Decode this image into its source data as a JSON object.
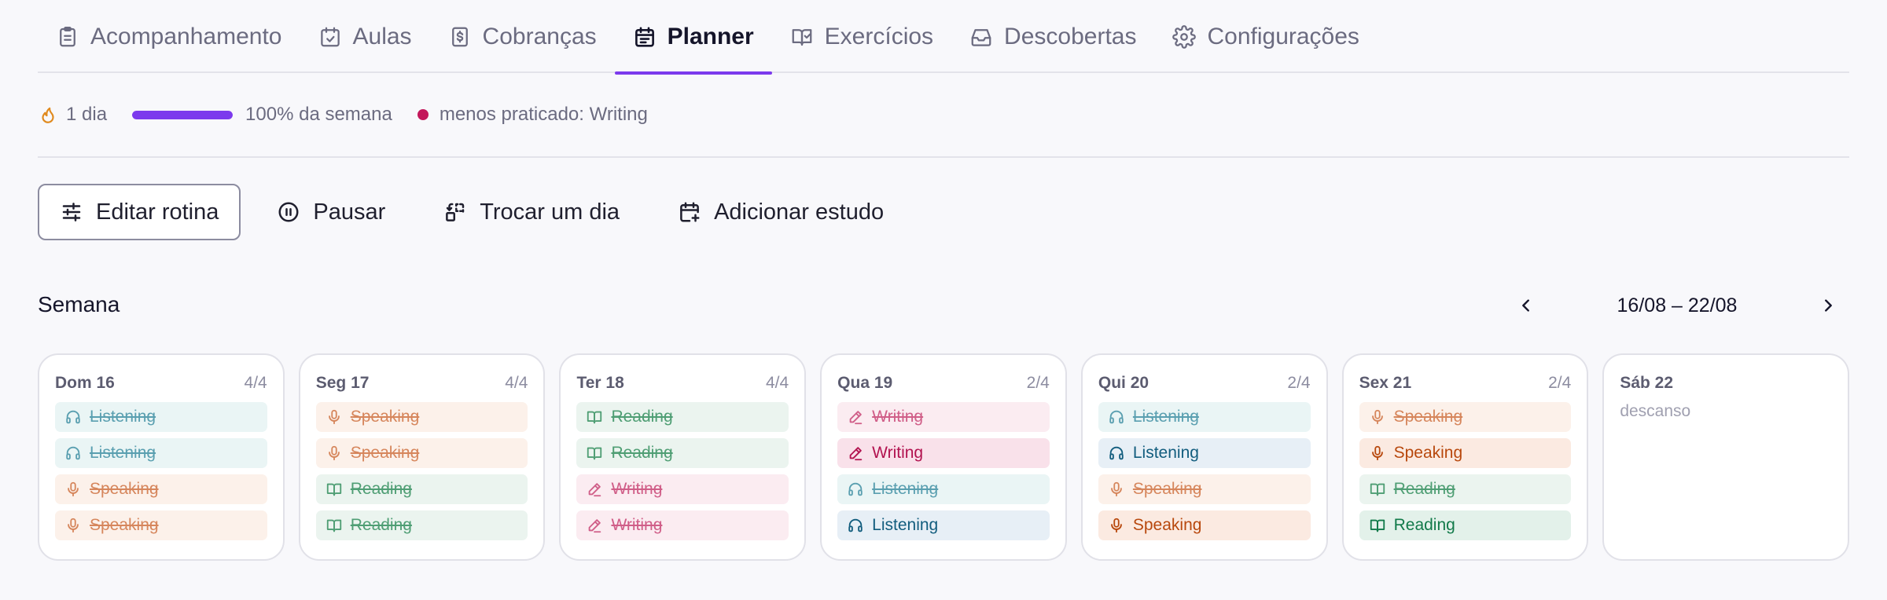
{
  "tabs": [
    {
      "label": "Acompanhamento",
      "icon": "clipboard-icon",
      "active": false
    },
    {
      "label": "Aulas",
      "icon": "calendar-check-icon",
      "active": false
    },
    {
      "label": "Cobranças",
      "icon": "receipt-dollar-icon",
      "active": false
    },
    {
      "label": "Planner",
      "icon": "calendar-planner-icon",
      "active": true
    },
    {
      "label": "Exercícios",
      "icon": "book-check-icon",
      "active": false
    },
    {
      "label": "Descobertas",
      "icon": "inbox-icon",
      "active": false
    },
    {
      "label": "Configurações",
      "icon": "gear-icon",
      "active": false
    }
  ],
  "status": {
    "streak_label": "1 dia",
    "week_progress_fraction": 1.0,
    "week_progress_label": "100% da semana",
    "least_practiced_label": "menos praticado: Writing",
    "colors": {
      "flame": "#e08a1e",
      "progress": "#7c3aed",
      "least_dot": "#c3185b"
    }
  },
  "actions": {
    "edit_routine": "Editar rotina",
    "pause": "Pausar",
    "swap_day": "Trocar um dia",
    "add_study": "Adicionar estudo"
  },
  "week": {
    "title": "Semana",
    "range": "16/08 – 22/08",
    "days": [
      {
        "name": "Dom 16",
        "count": "4/4",
        "tasks": [
          {
            "label": "Listening",
            "skill": "listening",
            "done": true
          },
          {
            "label": "Listening",
            "skill": "listening",
            "done": true
          },
          {
            "label": "Speaking",
            "skill": "speaking",
            "done": true
          },
          {
            "label": "Speaking",
            "skill": "speaking",
            "done": true
          }
        ]
      },
      {
        "name": "Seg 17",
        "count": "4/4",
        "tasks": [
          {
            "label": "Speaking",
            "skill": "speaking",
            "done": true
          },
          {
            "label": "Speaking",
            "skill": "speaking",
            "done": true
          },
          {
            "label": "Reading",
            "skill": "reading",
            "done": true
          },
          {
            "label": "Reading",
            "skill": "reading",
            "done": true
          }
        ]
      },
      {
        "name": "Ter 18",
        "count": "4/4",
        "tasks": [
          {
            "label": "Reading",
            "skill": "reading",
            "done": true
          },
          {
            "label": "Reading",
            "skill": "reading",
            "done": true
          },
          {
            "label": "Writing",
            "skill": "writing",
            "done": true
          },
          {
            "label": "Writing",
            "skill": "writing",
            "done": true
          }
        ]
      },
      {
        "name": "Qua 19",
        "count": "2/4",
        "tasks": [
          {
            "label": "Writing",
            "skill": "writing",
            "done": true
          },
          {
            "label": "Writing",
            "skill": "writing",
            "done": false
          },
          {
            "label": "Listening",
            "skill": "listening",
            "done": true
          },
          {
            "label": "Listening",
            "skill": "listening",
            "done": false
          }
        ]
      },
      {
        "name": "Qui 20",
        "count": "2/4",
        "tasks": [
          {
            "label": "Listening",
            "skill": "listening",
            "done": true
          },
          {
            "label": "Listening",
            "skill": "listening",
            "done": false
          },
          {
            "label": "Speaking",
            "skill": "speaking",
            "done": true
          },
          {
            "label": "Speaking",
            "skill": "speaking",
            "done": false
          }
        ]
      },
      {
        "name": "Sex 21",
        "count": "2/4",
        "tasks": [
          {
            "label": "Speaking",
            "skill": "speaking",
            "done": true
          },
          {
            "label": "Speaking",
            "skill": "speaking",
            "done": false
          },
          {
            "label": "Reading",
            "skill": "reading",
            "done": true
          },
          {
            "label": "Reading",
            "skill": "reading",
            "done": false
          }
        ]
      },
      {
        "name": "Sáb 22",
        "count": "",
        "rest_label": "descanso",
        "tasks": []
      }
    ]
  }
}
